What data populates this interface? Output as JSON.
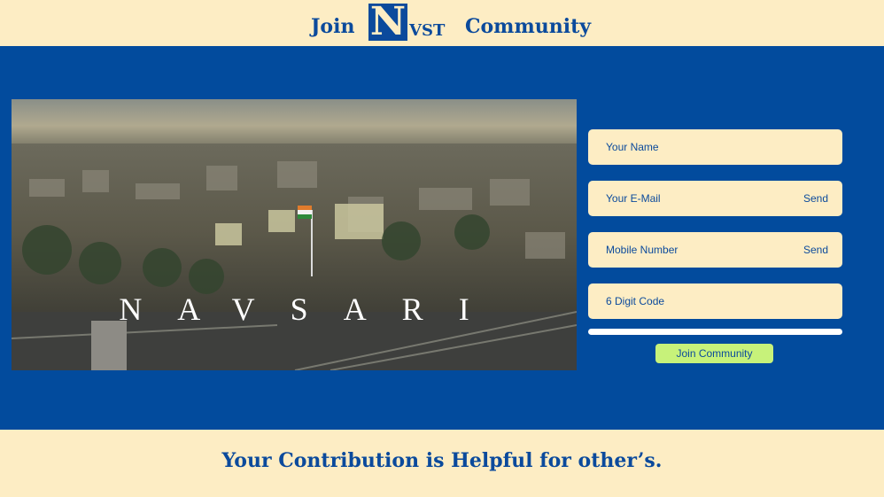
{
  "header": {
    "left_text": "Join",
    "logo_letter": "N",
    "logo_rest": "VST",
    "right_text": "Community"
  },
  "hero": {
    "caption": "NAVSARI"
  },
  "form": {
    "name_placeholder": "Your Name",
    "email_placeholder": "Your E-Mail",
    "email_send": "Send",
    "mobile_placeholder": "Mobile Number",
    "mobile_send": "Send",
    "code_placeholder": "6 Digit Code",
    "submit_label": "Join Community"
  },
  "footer": {
    "text": "Your Contribution is Helpful for other’s."
  },
  "colors": {
    "brand_blue": "#024b9d",
    "cream": "#fdedc4",
    "button_green": "#c7f27a"
  }
}
